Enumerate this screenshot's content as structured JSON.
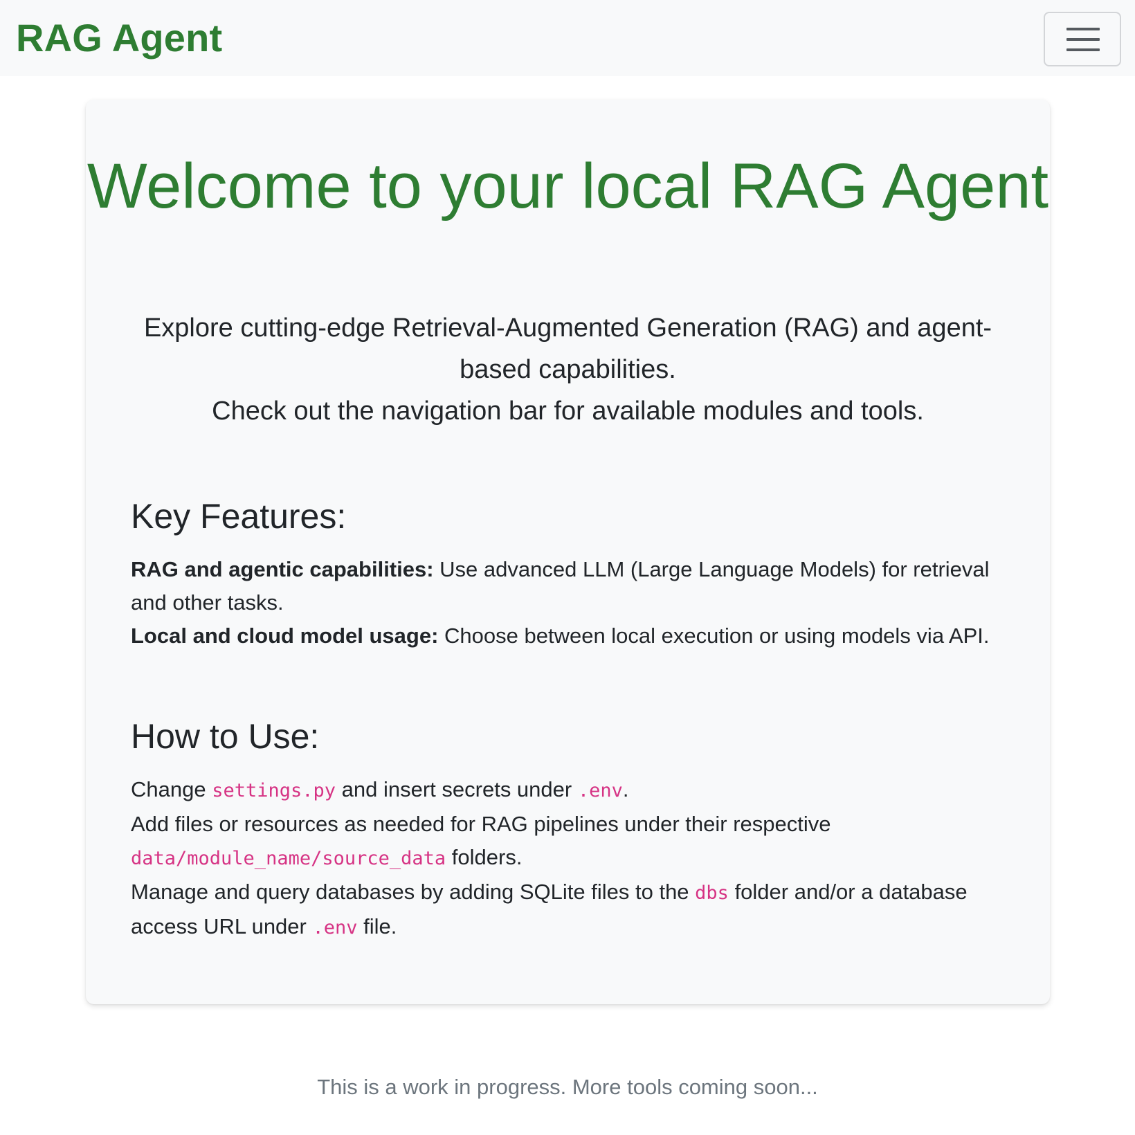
{
  "navbar": {
    "brand": "RAG Agent",
    "toggler_icon": "hamburger-menu-icon"
  },
  "hero": {
    "title": "Welcome to your local RAG Agent",
    "lead_line1": "Explore cutting-edge Retrieval-Augmented Generation (RAG) and agent-based capabilities.",
    "lead_line2": "Check out the navigation bar for available modules and tools."
  },
  "features": {
    "heading": "Key Features:",
    "items": [
      {
        "title": "RAG and agentic capabilities:",
        "text": " Use advanced LLM (Large Language Models) for retrieval and other tasks."
      },
      {
        "title": "Local and cloud model usage:",
        "text": " Choose between local execution or using models via API."
      }
    ]
  },
  "usage": {
    "heading": "How to Use:",
    "line1": {
      "pre": "Change ",
      "code1": "settings.py",
      "mid": " and insert secrets under ",
      "code2": ".env",
      "post": "."
    },
    "line2": {
      "pre": "Add files or resources as needed for RAG pipelines under their respective ",
      "code": "data/module_name/source_data",
      "post": " folders."
    },
    "line3": {
      "pre": "Manage and query databases by adding SQLite files to the ",
      "code1": "dbs",
      "mid": " folder and/or a database access URL under ",
      "code2": ".env",
      "post": " file."
    }
  },
  "footer": {
    "note": "This is a work in progress. More tools coming soon..."
  },
  "colors": {
    "brand_green": "#2e7d32",
    "code_pink": "#d63384",
    "muted_text": "#6c757d",
    "panel_bg": "#f8f9fa"
  }
}
